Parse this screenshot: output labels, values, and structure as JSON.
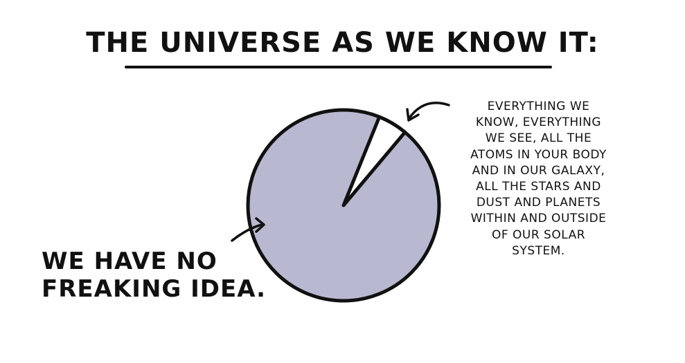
{
  "title": "THE UNIVERSE AS WE KNOW IT:",
  "chart_data": {
    "type": "pie",
    "slices": [
      {
        "label": "EVERYTHING WE\nKNOW, EVERYTHING\nWE SEE, ALL THE\nATOMS IN YOUR BODY\nAND IN OUR GALAXY,\nALL THE STARS AND\nDUST AND PLANETS\nWITHIN AND OUTSIDE\nOF OUR SOLAR\nSYSTEM.",
        "value": 5,
        "color": "#ffffff"
      },
      {
        "label": "WE HAVE NO\nFREAKING IDEA.",
        "value": 95,
        "color": "#b8b8d1"
      }
    ]
  },
  "colors": {
    "ink": "#111111",
    "unknown": "#b8b8d1",
    "known": "#ffffff"
  }
}
